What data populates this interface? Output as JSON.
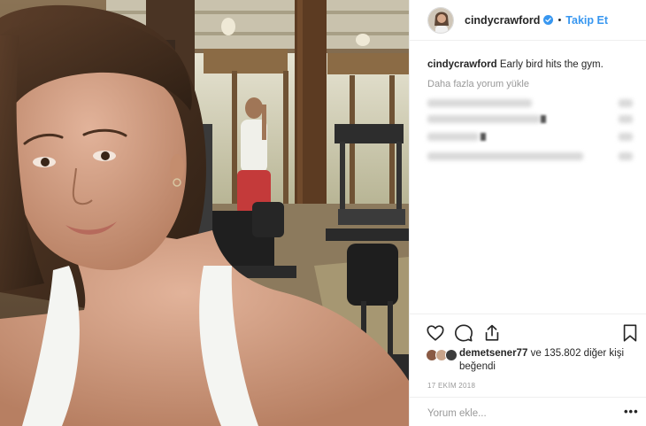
{
  "header": {
    "username": "cindycrawford",
    "separator": "•",
    "follow_label": "Takip Et"
  },
  "caption": {
    "username": "cindycrawford",
    "text": "Early bird hits the gym."
  },
  "comments": {
    "load_more_label": "Daha fazla yorum yükle"
  },
  "likes": {
    "user": "demetsener77",
    "rest": "ve 135.802 diğer kişi beğendi"
  },
  "date": "17 EKİM 2018",
  "comment_box": {
    "placeholder": "Yorum ekle...",
    "more_label": "•••"
  },
  "icons": {
    "like": "heart-icon",
    "comment": "comment-bubble-icon",
    "share": "share-icon",
    "save": "bookmark-icon",
    "verified": "verified-badge-icon"
  },
  "colors": {
    "accent": "#3897f0",
    "verified": "#3897f0",
    "muted_text": "#999999",
    "text": "#262626"
  }
}
